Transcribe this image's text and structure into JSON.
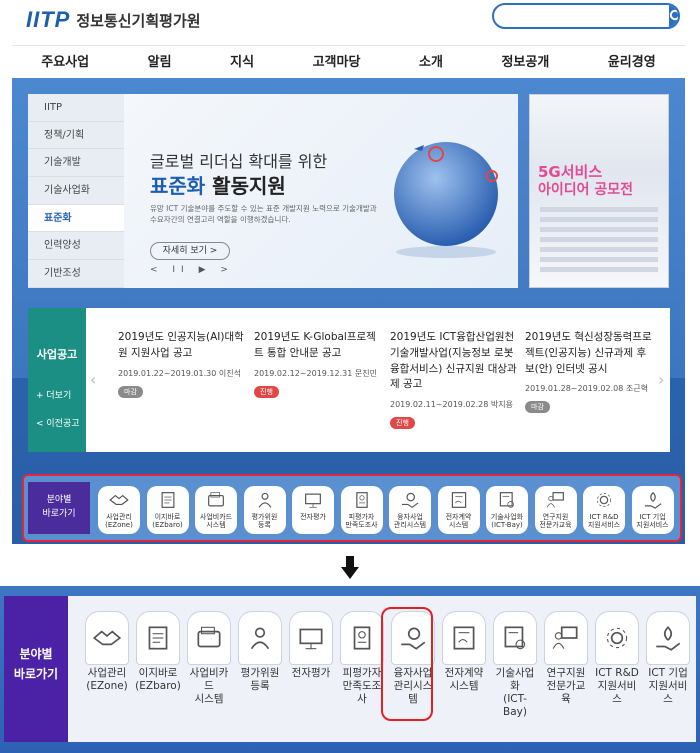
{
  "header": {
    "logo_mark": "IITP",
    "org_name": "정보통신기획평가원",
    "search_placeholder": ""
  },
  "gnb": [
    "주요사업",
    "알림",
    "지식",
    "고객마당",
    "소개",
    "정보공개",
    "윤리경영"
  ],
  "lnb": [
    {
      "label": "IITP",
      "active": false
    },
    {
      "label": "정책/기획",
      "active": false
    },
    {
      "label": "기술개발",
      "active": false
    },
    {
      "label": "기술사업화",
      "active": false
    },
    {
      "label": "표준화",
      "active": true
    },
    {
      "label": "인력양성",
      "active": false
    },
    {
      "label": "기반조성",
      "active": false
    }
  ],
  "banner": {
    "line1": "글로벌 리더십 확대를 위한",
    "line2_em": "표준화",
    "line2_rest": " 활동지원",
    "desc": "유망 ICT 기술분야를 주도할 수 있는 표준 개발지원 노력으로 기술개발과 수요자간의 연결고리 역할을 이행하겠습니다.",
    "more": "자세히 보기 >",
    "controls": "< II ▶ >"
  },
  "poster": {
    "title1": "5G서비스",
    "title2": "아이디어 공모전"
  },
  "notice": {
    "heading": "사업공고",
    "more": "+ 더보기",
    "prev": "< 이전공고",
    "items": [
      {
        "title": "2019년도 인공지능(AI)대학원 지원사업 공고",
        "date": "2019.01.22~2019.01.30 이진석",
        "status": "마감",
        "status_color": "gray"
      },
      {
        "title": "2019년도 K-Global프로젝트 통합 안내문 공고",
        "date": "2019.02.12~2019.12.31 문진민",
        "status": "진행",
        "status_color": "red"
      },
      {
        "title": "2019년도 ICT융합산업원천기술개발사업(지능정보 로봇 융합서비스) 신규지원 대상과제 공고",
        "date": "2019.02.11~2019.02.28 박지용",
        "status": "진행",
        "status_color": "red"
      },
      {
        "title": "2019년도 혁신성장동력프로젝트(인공지능) 신규과제 후보(안) 인터넷 공시",
        "date": "2019.01.28~2019.02.08 조근혁",
        "status": "마감",
        "status_color": "gray"
      }
    ]
  },
  "quick": {
    "label_line1": "분야별",
    "label_line2": "바로가기",
    "items": [
      {
        "l1": "사업관리",
        "l2": "(EZone)",
        "icon": "handshake-icon"
      },
      {
        "l1": "이지바로",
        "l2": "(EZbaro)",
        "icon": "document-icon"
      },
      {
        "l1": "사업비카드",
        "l2": "시스템",
        "icon": "wallet-icon"
      },
      {
        "l1": "평가위원",
        "l2": "등록",
        "icon": "person-icon"
      },
      {
        "l1": "전자평가",
        "l2": "",
        "icon": "monitor-icon"
      },
      {
        "l1": "피평가자",
        "l2": "만족도조사",
        "icon": "survey-icon"
      },
      {
        "l1": "융자사업",
        "l2": "관리시스템",
        "icon": "money-hand-icon"
      },
      {
        "l1": "전자계약",
        "l2": "시스템",
        "icon": "contract-icon"
      },
      {
        "l1": "기술사업화",
        "l2": "(ICT-Bay)",
        "icon": "certificate-icon"
      },
      {
        "l1": "연구지원",
        "l2": "전문가교육",
        "icon": "teacher-icon"
      },
      {
        "l1": "ICT R&D",
        "l2": "지원서비스",
        "icon": "gear-network-icon"
      },
      {
        "l1": "ICT 기업",
        "l2": "지원서비스",
        "icon": "plant-hand-icon"
      }
    ]
  },
  "colors": {
    "brand": "#1c5fb0",
    "highlight": "#e52025",
    "label_purple": "#4b22a6",
    "notice_teal": "#1c8f85"
  }
}
